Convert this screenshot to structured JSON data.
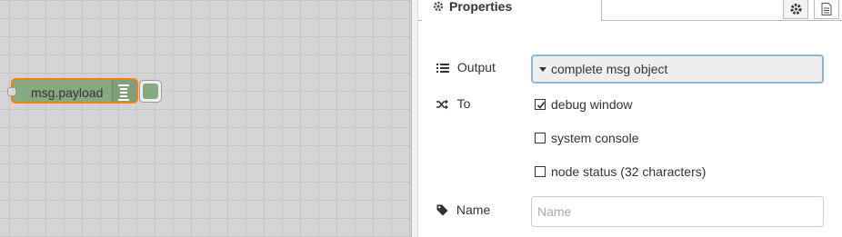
{
  "canvas": {
    "node": {
      "label": "msg.payload",
      "icon": "debug-list-icon",
      "color": "#87a980",
      "selected_border": "#ff7f0e"
    },
    "toggle_icon": "node-toggle-button"
  },
  "tray": {
    "tabs": {
      "active_label": "Properties",
      "active_icon": "gear-icon",
      "buttons": [
        {
          "icon": "gear-icon"
        },
        {
          "icon": "document-icon"
        }
      ]
    },
    "output": {
      "label": "Output",
      "icon": "list-icon",
      "selected": "complete msg object"
    },
    "to": {
      "label": "To",
      "icon": "random-icon",
      "options": [
        {
          "label": "debug window",
          "checked": true
        },
        {
          "label": "system console",
          "checked": false
        },
        {
          "label": "node status (32 characters)",
          "checked": false
        }
      ]
    },
    "name": {
      "label": "Name",
      "icon": "tag-icon",
      "value": "",
      "placeholder": "Name"
    }
  }
}
